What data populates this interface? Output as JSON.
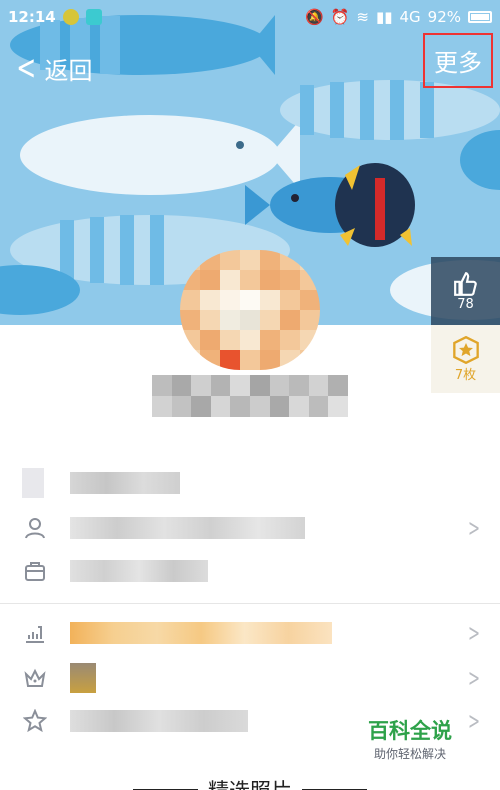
{
  "status_bar": {
    "time": "12:14",
    "network": "4G",
    "battery": "92%",
    "icons": [
      "mute-icon",
      "alarm-icon",
      "wifi-icon",
      "signal-icon",
      "signal-icon",
      "battery-icon"
    ]
  },
  "nav": {
    "back_label": "返回",
    "more_label": "更多"
  },
  "likes": {
    "count": "78",
    "icon": "thumbs-up-icon"
  },
  "charm": {
    "count": "7枚",
    "icon": "star-badge-icon"
  },
  "profile_rows": [
    {
      "icon": "profile-icon",
      "arrow": true
    },
    {
      "icon": "briefcase-icon",
      "arrow": false
    },
    {
      "icon": "level-icon",
      "arrow": true
    },
    {
      "icon": "crown-icon",
      "arrow": true
    },
    {
      "icon": "star-icon",
      "arrow": true
    }
  ],
  "watermark": {
    "title": "百科全说",
    "subtitle": "助你轻松解决"
  },
  "section": {
    "title": "精选照片"
  },
  "colors": {
    "banner": "#8fc9ea",
    "highlight": "#e33333",
    "accent_green": "#2ea24a",
    "charm_gold": "#e0a52a"
  }
}
